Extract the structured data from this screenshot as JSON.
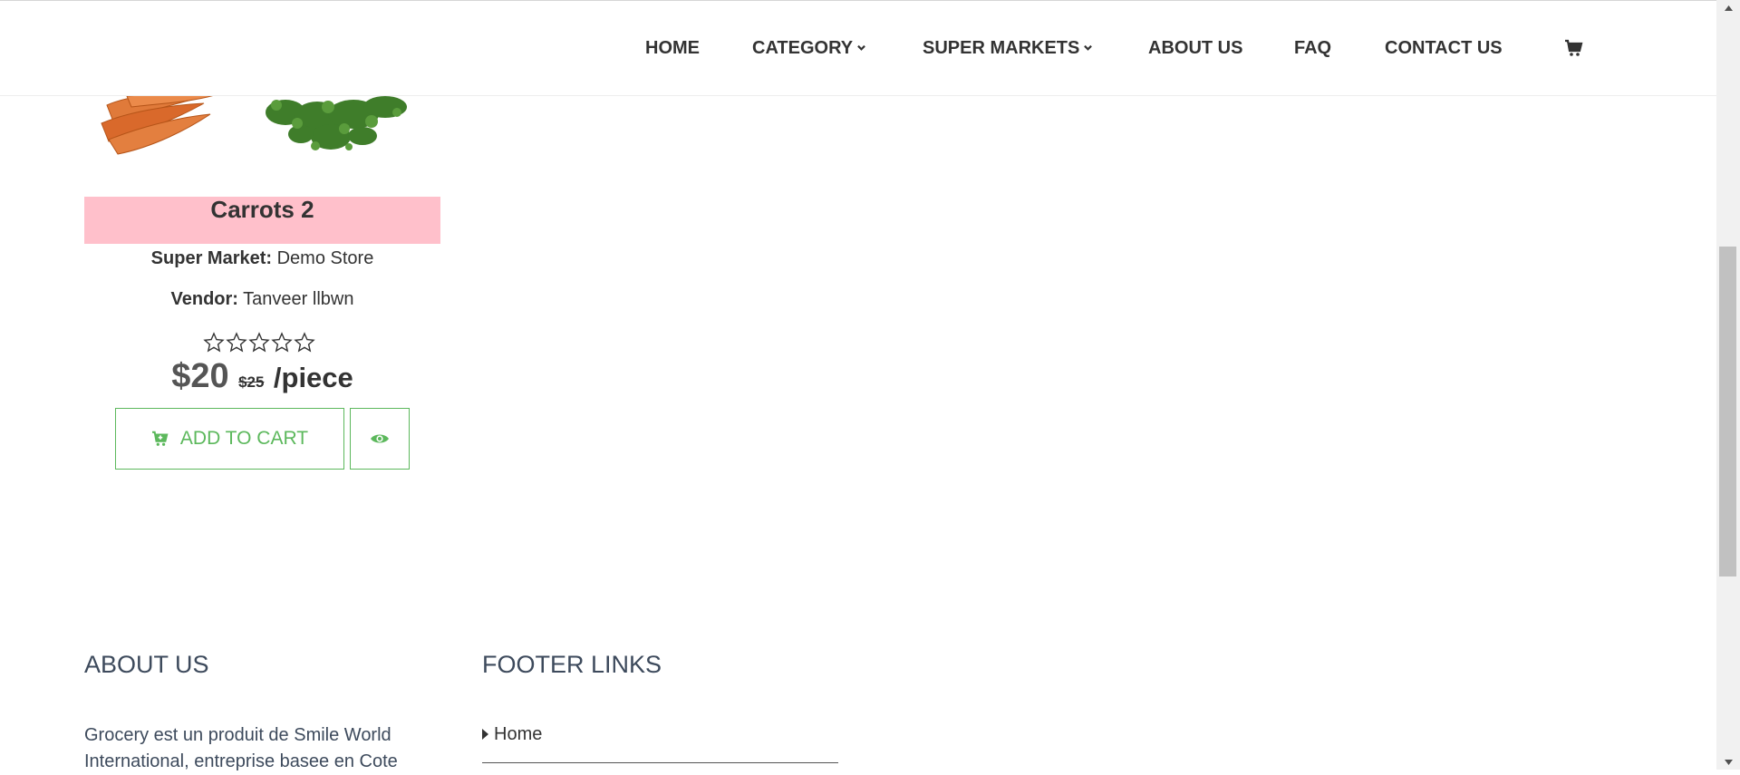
{
  "colors": {
    "accent_green": "#5cb85c",
    "title_band_pink": "#ffc0cb",
    "footer_text": "#3d4a5c"
  },
  "nav": {
    "items": [
      {
        "label": "HOME",
        "has_dropdown": false
      },
      {
        "label": "CATEGORY",
        "has_dropdown": true
      },
      {
        "label": "SUPER MARKETS",
        "has_dropdown": true
      },
      {
        "label": "ABOUT US",
        "has_dropdown": false
      },
      {
        "label": "FAQ",
        "has_dropdown": false
      },
      {
        "label": "CONTACT US",
        "has_dropdown": false
      }
    ],
    "cart_icon": "shopping-cart-icon"
  },
  "product": {
    "image_alt": "carrots",
    "title": "Carrots 2",
    "super_market_label": "Super Market:",
    "super_market_value": "Demo Store",
    "vendor_label": "Vendor:",
    "vendor_value": "Tanveer llbwn",
    "rating": 0,
    "rating_max": 5,
    "price": "$20",
    "old_price": "$25",
    "unit": "/piece",
    "add_to_cart_label": "ADD TO CART",
    "view_icon": "eye-icon"
  },
  "footer": {
    "about_heading": "ABOUT US",
    "about_text": "Grocery est un produit de Smile World International, entreprise basee en Cote",
    "links_heading": "FOOTER LINKS",
    "links": [
      {
        "label": "Home"
      }
    ]
  }
}
